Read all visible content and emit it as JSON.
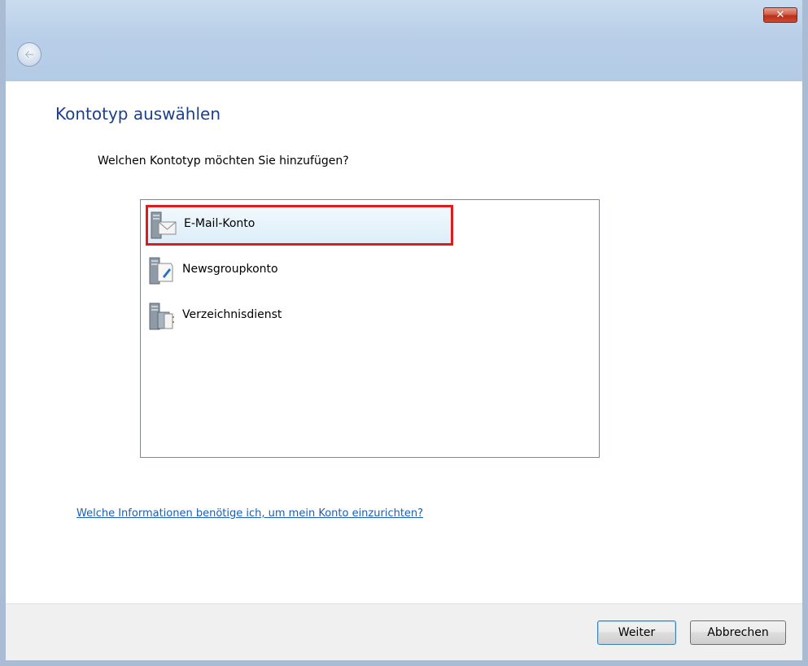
{
  "window": {
    "close_label": "✕"
  },
  "nav": {
    "back_icon": "back-arrow-icon"
  },
  "page": {
    "heading": "Kontotyp auswählen",
    "question": "Welchen Kontotyp möchten Sie hinzufügen?"
  },
  "account_types": [
    {
      "label": "E-Mail-Konto",
      "icon": "email-account-icon",
      "selected": true
    },
    {
      "label": "Newsgroupkonto",
      "icon": "newsgroup-account-icon",
      "selected": false
    },
    {
      "label": "Verzeichnisdienst",
      "icon": "directory-service-icon",
      "selected": false
    }
  ],
  "help": {
    "link_text": "Welche Informationen benötige ich, um mein Konto einzurichten?"
  },
  "buttons": {
    "next_label": "Weiter",
    "cancel_label": "Abbrechen"
  },
  "colors": {
    "heading": "#1e3f8a",
    "link": "#1a5fb4",
    "highlight_border": "#e01b1b",
    "titlebar": "#b9cfe8"
  }
}
